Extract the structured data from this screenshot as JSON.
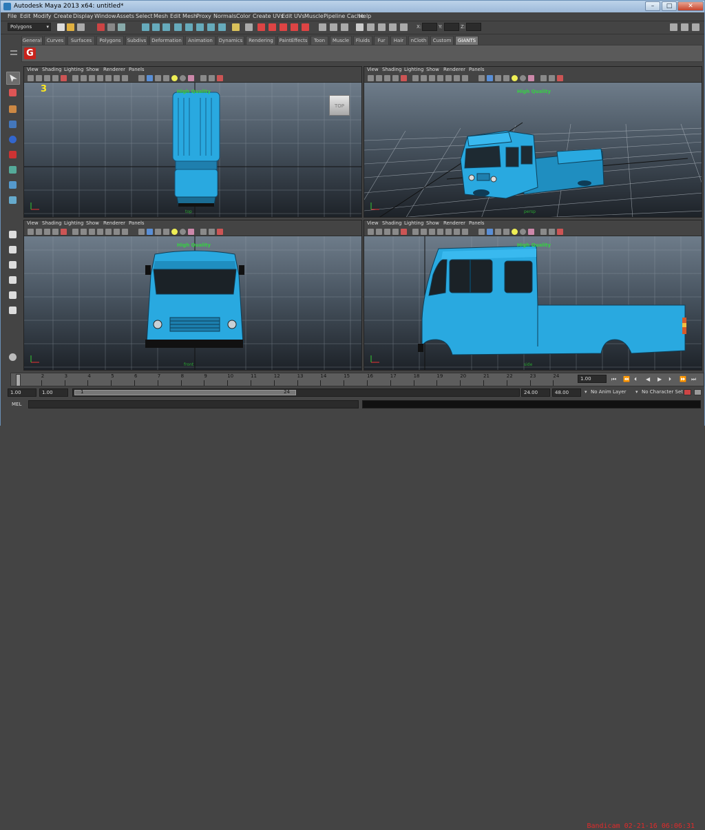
{
  "window": {
    "title": "Autodesk Maya 2013 x64: untitled*",
    "controls": {
      "minimize": "–",
      "maximize": "□",
      "close": "✕"
    }
  },
  "menubar": [
    "File",
    "Edit",
    "Modify",
    "Create",
    "Display",
    "Window",
    "Assets",
    "Select",
    "Mesh",
    "Edit Mesh",
    "Proxy",
    "Normals",
    "Color",
    "Create UVs",
    "Edit UVs",
    "Muscle",
    "Pipeline Cache",
    "Help"
  ],
  "statusline": {
    "mode": "Polygons",
    "coords": {
      "x_label": "X:",
      "y_label": "Y:",
      "z_label": "Z:"
    }
  },
  "shelf": {
    "tabs": [
      "General",
      "Curves",
      "Surfaces",
      "Polygons",
      "Subdivs",
      "Deformation",
      "Animation",
      "Dynamics",
      "Rendering",
      "PaintEffects",
      "Toon",
      "Muscle",
      "Fluids",
      "Fur",
      "Hair",
      "nCloth",
      "Custom",
      "GIANTS"
    ],
    "active_tab": "GIANTS",
    "icon_letter": "G"
  },
  "viewport_menu": [
    "View",
    "Shading",
    "Lighting",
    "Show",
    "Renderer",
    "Panels"
  ],
  "viewports": {
    "top": {
      "hud": "High Quality",
      "cube_label": "TOP",
      "camera": "top",
      "badge": "3"
    },
    "persp": {
      "hud": "High Quality",
      "camera": "persp"
    },
    "front": {
      "hud": "High Quality",
      "camera": "front"
    },
    "side": {
      "hud": "High Quality",
      "camera": "side"
    }
  },
  "timeslider": {
    "ticks": [
      "1",
      "2",
      "3",
      "4",
      "5",
      "6",
      "7",
      "8",
      "9",
      "10",
      "11",
      "12",
      "13",
      "14",
      "15",
      "16",
      "17",
      "18",
      "19",
      "20",
      "21",
      "22",
      "23",
      "24"
    ],
    "current_frame": "1.00"
  },
  "rangeslider": {
    "start": "1.00",
    "anim_start": "1.00",
    "range_min_label": "1",
    "range_max_label": "24",
    "anim_end": "24.00",
    "end": "48.00",
    "anim_layer": "No Anim Layer",
    "char_set": "No Character Set"
  },
  "cmdline": {
    "label": "MEL"
  },
  "stamp": "Bandicam 02-21-16 06:06:31",
  "colors": {
    "model": "#29a9e0",
    "hud": "#36d042",
    "stamp": "#e02a2a"
  }
}
